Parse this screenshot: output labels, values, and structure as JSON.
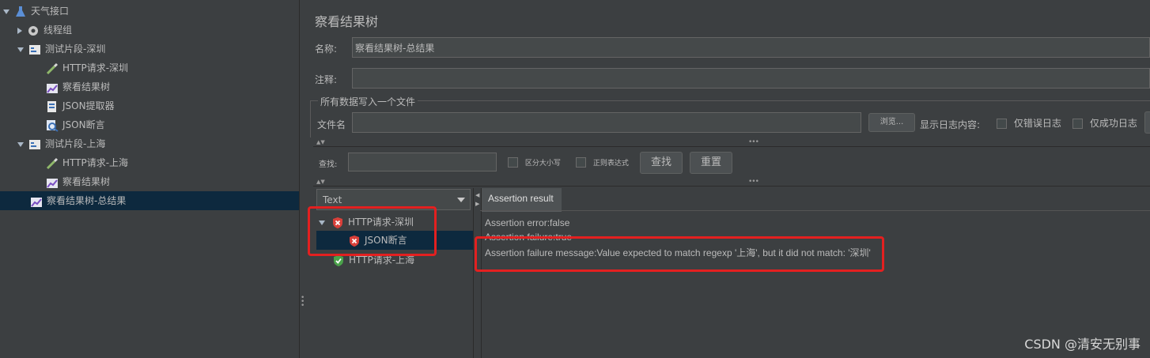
{
  "tree": {
    "root": "天气接口",
    "thread_group": "线程组",
    "fragment_sz": "测试片段-深圳",
    "http_sz": "HTTP请求-深圳",
    "viewer_1": "察看结果树",
    "json_extractor": "JSON提取器",
    "json_assert": "JSON断言",
    "fragment_sh": "测试片段-上海",
    "http_sh": "HTTP请求-上海",
    "viewer_2": "察看结果树",
    "viewer_total": "察看结果树-总结果"
  },
  "panel": {
    "title": "察看结果树",
    "name_label": "名称:",
    "name_value": "察看结果树-总结果",
    "comment_label": "注释:",
    "comment_value": "",
    "file_section": "所有数据写入一个文件",
    "filename_label": "文件名",
    "filename_value": "",
    "browse_button": "浏览...",
    "log_label": "显示日志内容:",
    "errors_only": "仅错误日志",
    "success_only": "仅成功日志"
  },
  "search": {
    "label": "查找:",
    "value": "",
    "case_sensitive": "区分大小写",
    "regex": "正则表达式",
    "find_button": "查找",
    "reset_button": "重置"
  },
  "results": {
    "renderer": "Text",
    "items": [
      {
        "label": "HTTP请求-深圳",
        "status": "fail"
      },
      {
        "label": "JSON断言",
        "status": "fail"
      },
      {
        "label": "HTTP请求-上海",
        "status": "pass"
      }
    ]
  },
  "detail": {
    "tab": "Assertion result",
    "line1": "Assertion error:false",
    "line2": "Assertion failure:true",
    "line3": "Assertion failure message:Value expected to match regexp '上海', but it did not match: '深圳'"
  },
  "watermark": "CSDN @清安无别事",
  "colors": {
    "background": "#3c3f41",
    "selection": "#0d293e",
    "highlight_box": "#e32020",
    "fail_icon": "#d9403a",
    "pass_icon": "#4aa24a"
  }
}
